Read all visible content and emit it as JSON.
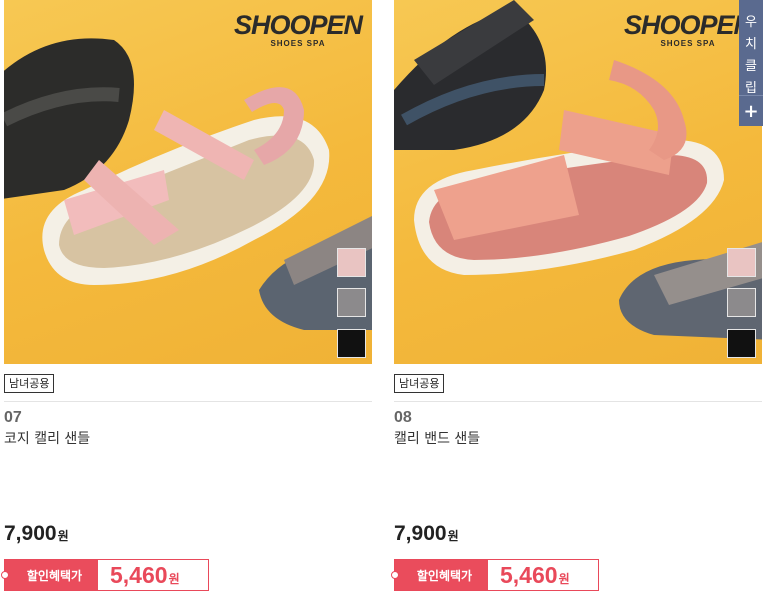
{
  "products": [
    {
      "brand": "SHOOPEN",
      "brand_sub": "SHOES SPA",
      "tag": "남녀공용",
      "number": "07",
      "name": "코지 캘리 샌들",
      "price": "7,900",
      "price_unit": "원",
      "discount_label": "할인혜택가",
      "discount_price": "5,460",
      "discount_unit": "원",
      "swatches": [
        "#e9c4c2",
        "#8c8a8c",
        "#111111"
      ]
    },
    {
      "brand": "SHOOPEN",
      "brand_sub": "SHOES SPA",
      "tag": "남녀공용",
      "number": "08",
      "name": "캘리 밴드 샌들",
      "price": "7,900",
      "price_unit": "원",
      "discount_label": "할인혜택가",
      "discount_price": "5,460",
      "discount_unit": "원",
      "swatches": [
        "#e9c4c2",
        "#8c8a8c",
        "#111111"
      ]
    }
  ],
  "side_widget": {
    "chars": [
      "우",
      "치",
      "클",
      "립"
    ],
    "plus": "+"
  },
  "colors": {
    "accent": "#ea4c5c",
    "side": "#5a6a8f"
  }
}
